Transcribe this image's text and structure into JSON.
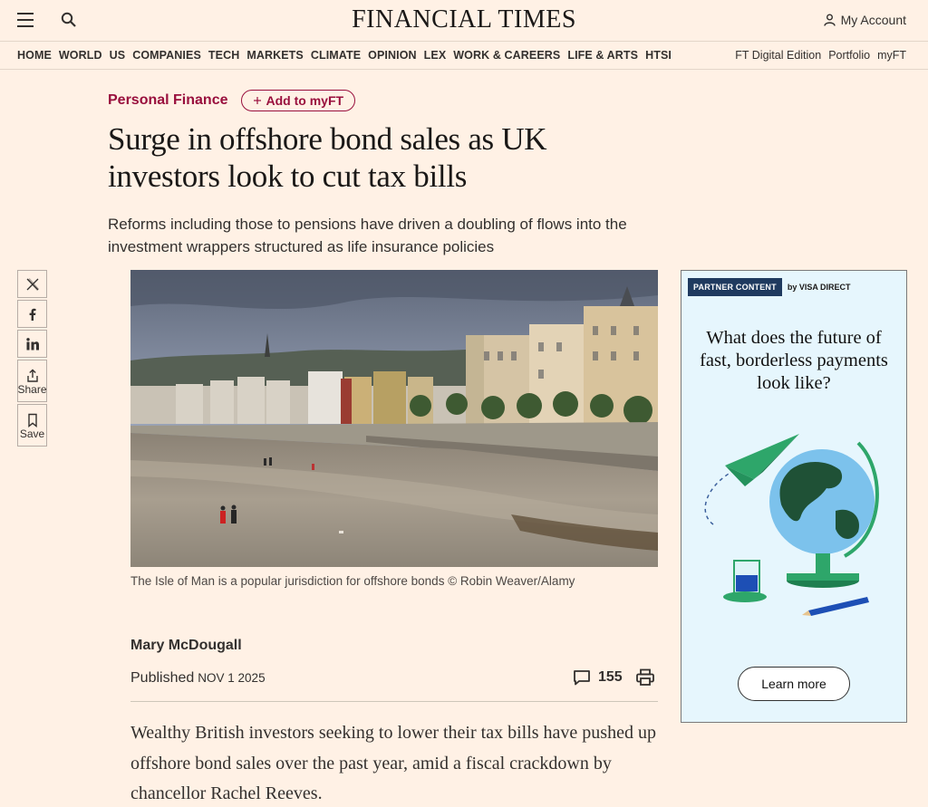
{
  "header": {
    "masthead": "FINANCIAL TIMES",
    "account_label": "My Account"
  },
  "nav": {
    "left": [
      "HOME",
      "WORLD",
      "US",
      "COMPANIES",
      "TECH",
      "MARKETS",
      "CLIMATE",
      "OPINION",
      "LEX",
      "WORK & CAREERS",
      "LIFE & ARTS",
      "HTSI"
    ],
    "right": [
      "FT Digital Edition",
      "Portfolio",
      "myFT"
    ]
  },
  "article": {
    "topic": "Personal Finance",
    "add_myft": "Add to myFT",
    "headline": "Surge in offshore bond sales as UK investors look to cut tax bills",
    "standfirst": "Reforms including those to pensions have driven a doubling of flows into the investment wrappers structured as life insurance policies",
    "caption": "The Isle of Man is a popular jurisdiction for offshore bonds © Robin Weaver/Alamy",
    "author": "Mary McDougall",
    "published_label": "Published",
    "published_date": "NOV 1 2025",
    "comment_count": "155",
    "body": "Wealthy British investors seeking to lower their tax bills have pushed up offshore bond sales over the past year, amid a fiscal crackdown by chancellor Rachel Reeves."
  },
  "share": {
    "share_label": "Share",
    "save_label": "Save"
  },
  "ad": {
    "tag": "PARTNER CONTENT",
    "by": "by VISA DIRECT",
    "headline": "What does the future of fast, borderless payments look like?",
    "cta": "Learn more"
  },
  "icons": [
    "hamburger-icon",
    "search-icon",
    "user-icon",
    "plus-icon",
    "x-icon",
    "facebook-icon",
    "linkedin-icon",
    "share-icon",
    "bookmark-icon",
    "comment-icon",
    "print-icon"
  ],
  "colors": {
    "background": "#fff1e5",
    "accent": "#990f3d",
    "text": "#33302e",
    "ad_background": "#e6f6fd"
  }
}
